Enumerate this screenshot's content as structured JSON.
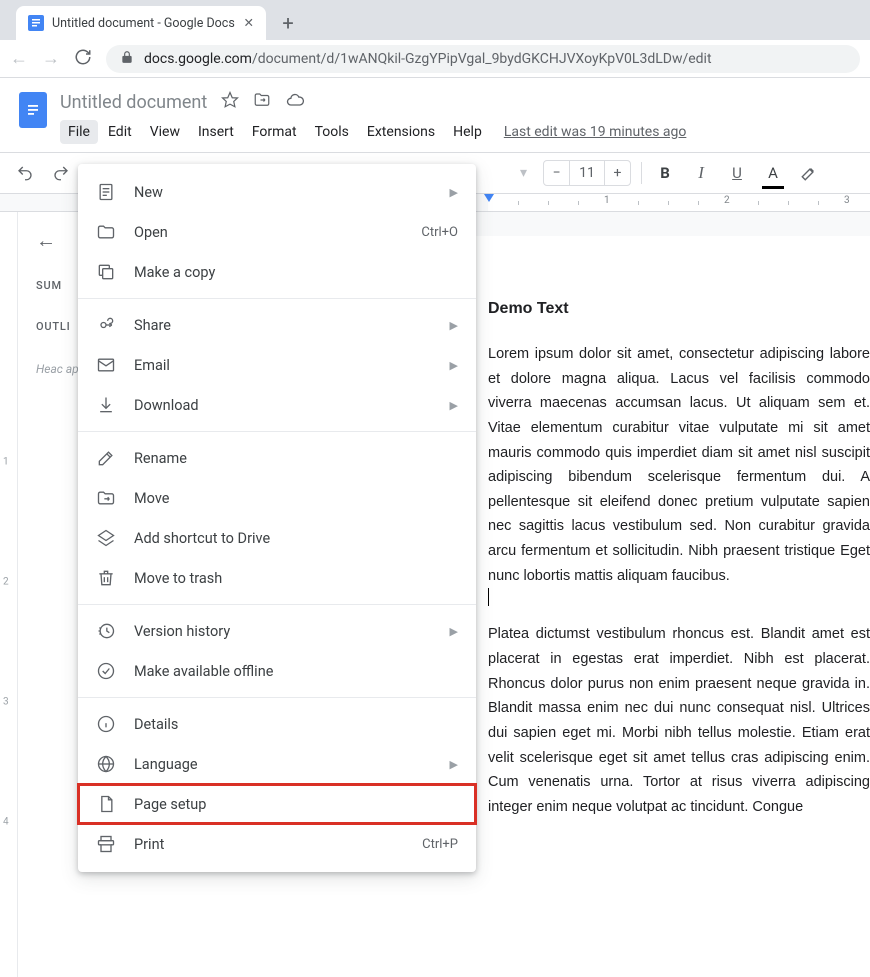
{
  "browser": {
    "tab_title": "Untitled document - Google Docs",
    "url_host": "docs.google.com",
    "url_path": "/document/d/1wANQkil-GzgYPipVgal_9bydGKCHJVXoyKpV0L3dLDw/edit"
  },
  "doc": {
    "title": "Untitled document",
    "last_edit": "Last edit was 19 minutes ago"
  },
  "menubar": [
    "File",
    "Edit",
    "View",
    "Insert",
    "Format",
    "Tools",
    "Extensions",
    "Help"
  ],
  "toolbar": {
    "font_size": "11"
  },
  "ruler": {
    "marks": [
      "1",
      "2",
      "3"
    ]
  },
  "vruler": {
    "marks": [
      "1",
      "2",
      "3",
      "4"
    ]
  },
  "outline": {
    "summary_label": "SUM",
    "outline_label": "OUTLI",
    "hint": "Heac appe"
  },
  "content": {
    "heading": "Demo Text",
    "para1": "Lorem ipsum dolor sit amet, consectetur adipiscing labore et dolore magna aliqua. Lacus vel facilisis commodo viverra maecenas accumsan lacus. Ut aliquam sem et. Vitae elementum curabitur vitae vulputate mi sit amet mauris commodo quis imperdiet diam sit amet nisl suscipit adipiscing bibendum scelerisque fermentum dui. A pellentesque sit eleifend donec pretium vulputate sapien nec sagittis lacus vestibulum sed. Non curabitur gravida arcu fermentum et sollicitudin. Nibh praesent tristique Eget nunc lobortis mattis aliquam faucibus.",
    "para2": "Platea dictumst vestibulum rhoncus est. Blandit amet est placerat in egestas erat imperdiet. Nibh est placerat. Rhoncus dolor purus non enim praesent neque gravida in. Blandit massa enim nec dui nunc consequat nisl. Ultrices dui sapien eget mi. Morbi nibh tellus molestie. Etiam erat velit scelerisque eget sit amet tellus cras adipiscing enim. Cum venenatis urna. Tortor at risus viverra adipiscing integer enim neque volutpat ac tincidunt. Congue"
  },
  "file_menu": {
    "items": [
      {
        "icon": "doc",
        "label": "New",
        "arrow": true
      },
      {
        "icon": "folder",
        "label": "Open",
        "shortcut": "Ctrl+O"
      },
      {
        "icon": "copy",
        "label": "Make a copy"
      },
      "sep",
      {
        "icon": "share",
        "label": "Share",
        "arrow": true
      },
      {
        "icon": "email",
        "label": "Email",
        "arrow": true
      },
      {
        "icon": "download",
        "label": "Download",
        "arrow": true
      },
      "sep",
      {
        "icon": "rename",
        "label": "Rename"
      },
      {
        "icon": "move",
        "label": "Move"
      },
      {
        "icon": "shortcut",
        "label": "Add shortcut to Drive"
      },
      {
        "icon": "trash",
        "label": "Move to trash"
      },
      "sep",
      {
        "icon": "history",
        "label": "Version history",
        "arrow": true
      },
      {
        "icon": "offline",
        "label": "Make available offline"
      },
      "sep",
      {
        "icon": "info",
        "label": "Details"
      },
      {
        "icon": "language",
        "label": "Language",
        "arrow": true
      },
      {
        "icon": "pagesetup",
        "label": "Page setup",
        "highlight": true
      },
      {
        "icon": "print",
        "label": "Print",
        "shortcut": "Ctrl+P"
      }
    ]
  }
}
